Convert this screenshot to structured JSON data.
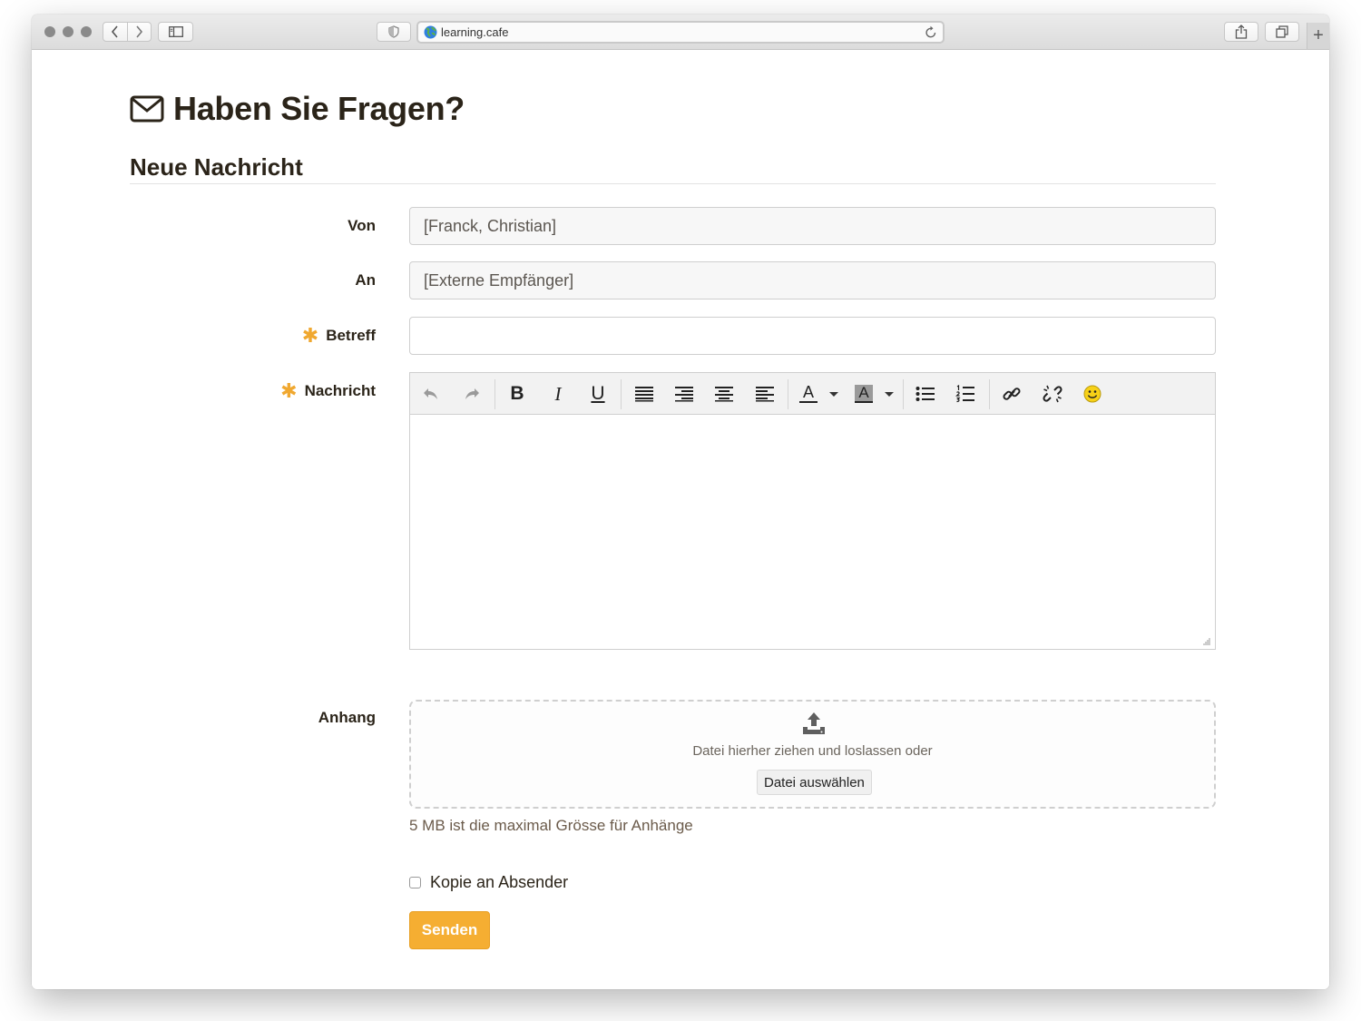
{
  "browser": {
    "url": "learning.cafe",
    "new_tab_label": "+",
    "icons": {
      "traffic_lights": "window-controls",
      "back": "chevron-left-icon",
      "forward": "chevron-right-icon",
      "sidebar": "sidebar-icon",
      "privacy": "shield-icon",
      "site": "globe-icon",
      "reload": "reload-icon",
      "share": "share-icon",
      "tabs": "tabs-icon"
    }
  },
  "page": {
    "title": "Haben Sie Fragen?",
    "title_icon": "envelope-icon",
    "section_title": "Neue Nachricht"
  },
  "form": {
    "from": {
      "label": "Von",
      "value": "[Franck, Christian]"
    },
    "to": {
      "label": "An",
      "value": "[Externe Empfänger]"
    },
    "subject": {
      "label": "Betreff",
      "value": "",
      "required_mark": "✱"
    },
    "message": {
      "label": "Nachricht",
      "value": "",
      "required_mark": "✱"
    },
    "attachment": {
      "label": "Anhang",
      "drop_text": "Datei hierher ziehen und loslassen oder",
      "choose_button": "Datei auswählen",
      "hint": "5 MB ist die maximal Grösse für Anhänge"
    },
    "copy_to_sender": {
      "label": "Kopie an Absender",
      "checked": false
    },
    "submit_label": "Senden"
  },
  "editor_toolbar": {
    "bold": "B",
    "italic": "I",
    "underline": "U",
    "text_color": "A",
    "background_color": "A"
  },
  "colors": {
    "accent": "#f5ae32",
    "required": "#f0a830",
    "heading": "#2b2419",
    "hint": "#6b5b4b"
  }
}
